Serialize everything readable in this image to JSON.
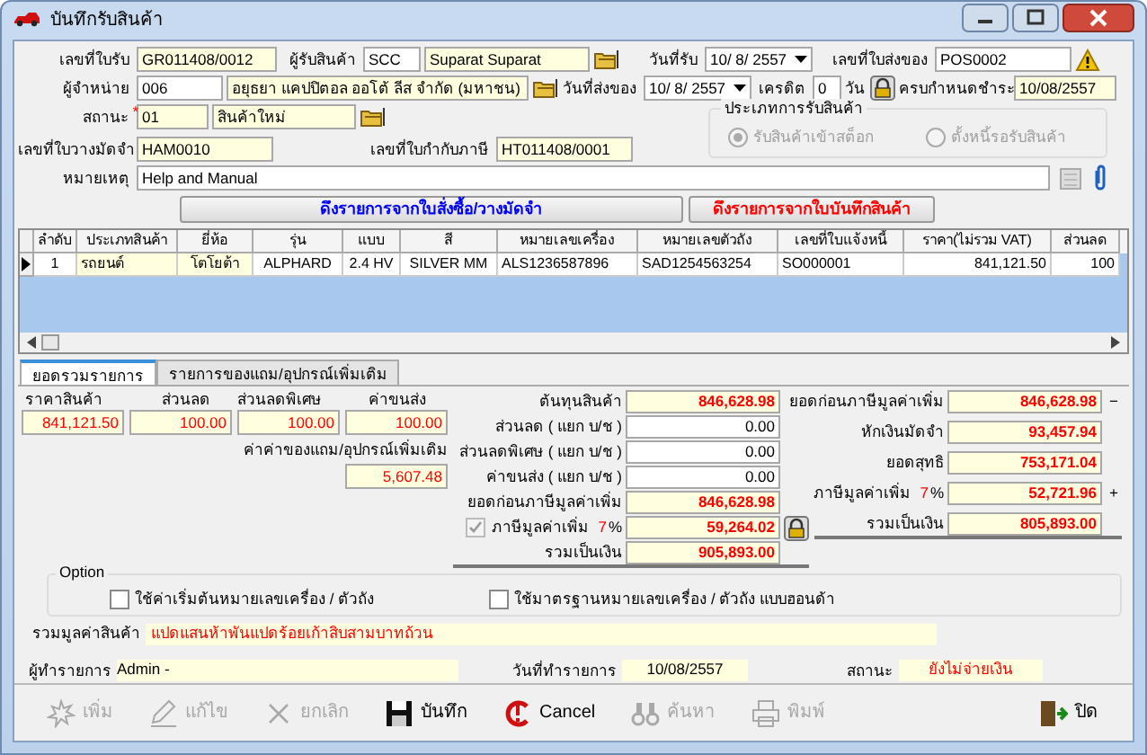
{
  "window": {
    "title": "บันทึกรับสินค้า"
  },
  "header": {
    "receipt_no": {
      "label": "เลขที่ใบรับ",
      "value": "GR011408/0012"
    },
    "receiver": {
      "label": "ผู้รับสินค้า",
      "code": "SCC",
      "name": "Suparat Suparat"
    },
    "receive_date": {
      "label": "วันที่รับ",
      "value": "10/ 8/ 2557"
    },
    "delivery_no": {
      "label": "เลขที่ใบส่งของ",
      "value": "POS0002"
    },
    "supplier": {
      "label": "ผู้จำหน่าย",
      "code": "006",
      "name": "อยุธยา แคปปิตอล ออโต้ ลีส จำกัด (มหาชน)"
    },
    "delivery_date": {
      "label": "วันที่ส่งของ",
      "value": "10/ 8/ 2557"
    },
    "credit": {
      "label": "เครดิต",
      "value": "0",
      "unit": "วัน"
    },
    "due_date": {
      "label": "ครบกำหนดชำระ",
      "value": "10/08/2557"
    },
    "status": {
      "label": "สถานะ",
      "required": true,
      "required_mark": "*",
      "code": "01",
      "name": "สินค้าใหม่"
    },
    "deposit_no": {
      "label": "เลขที่ใบวางมัดจำ",
      "value": "HAM0010"
    },
    "tax_invoice_no": {
      "label": "เลขที่ใบกำกับภาษี",
      "value": "HT011408/0001"
    },
    "receive_type": {
      "title": "ประเภทการรับสินค้า",
      "disabled": true,
      "options": [
        {
          "label": "รับสินค้าเข้าสต็อก",
          "selected": true
        },
        {
          "label": "ตั้งหนี้รอรับสินค้า",
          "selected": false
        }
      ]
    },
    "remark": {
      "label": "หมายเหตุ",
      "value": "Help and Manual"
    }
  },
  "pull_buttons": [
    {
      "label": "ดึงรายการจากใบสั่งซื้อ/วางมัดจำ",
      "color": "#0000ff"
    },
    {
      "label": "ดึงรายการจากใบบันทึกสินค้า",
      "color": "#ff0000"
    }
  ],
  "table": {
    "columns": [
      "ลำดับ",
      "ประเภทสินค้า",
      "ยี่ห้อ",
      "รุ่น",
      "แบบ",
      "สี",
      "หมายเลขเครื่อง",
      "หมายเลขตัวถัง",
      "เลขที่ใบแจ้งหนี้",
      "ราคา(ไม่รวม VAT)",
      "ส่วนลด"
    ],
    "rows": [
      {
        "selected": true,
        "cells": [
          "1",
          "รถยนต์",
          "โตโยต้า",
          "ALPHARD",
          "2.4 HV",
          "SILVER MM",
          "ALS1236587896",
          "SAD1254563254",
          "SO000001",
          "841,121.50",
          "100"
        ]
      }
    ]
  },
  "tabs": [
    {
      "label": "ยอดรวมรายการ",
      "selected": true
    },
    {
      "label": "รายการของแถม/อุปกรณ์เพิ่มเติม",
      "selected": false
    }
  ],
  "summary": {
    "line_totals": [
      {
        "label": "ราคาสินค้า",
        "value": "841,121.50"
      },
      {
        "label": "ส่วนลด",
        "value": "100.00"
      },
      {
        "label": "ส่วนลดพิเศษ",
        "value": "100.00"
      },
      {
        "label": "ค่าขนส่ง",
        "value": "100.00"
      }
    ],
    "extras": {
      "label": "ค่าค่าของแถม/อุปกรณ์เพิ่มเติม",
      "value": "5,607.48"
    },
    "middle": [
      {
        "kind": "total",
        "label": "ต้นทุนสินค้า",
        "value": "846,628.98"
      },
      {
        "kind": "input",
        "label": "ส่วนลด ( แยก บ/ช )",
        "value": "0.00"
      },
      {
        "kind": "input",
        "label": "ส่วนลดพิเศษ ( แยก บ/ช )",
        "value": "0.00"
      },
      {
        "kind": "input",
        "label": "ค่าขนส่ง ( แยก บ/ช )",
        "value": "0.00"
      },
      {
        "kind": "total",
        "label": "ยอดก่อนภาษีมูลค่าเพิ่ม",
        "value": "846,628.98"
      },
      {
        "kind": "vat",
        "label": "ภาษีมูลค่าเพิ่ม",
        "checked": true,
        "rate": "7",
        "unit": "%",
        "value": "59,264.02"
      },
      {
        "kind": "grand",
        "label": "รวมเป็นเงิน",
        "value": "905,893.00"
      }
    ],
    "right": [
      {
        "kind": "total",
        "label": "ยอดก่อนภาษีมูลค่าเพิ่ม",
        "value": "846,628.98",
        "sign": "−"
      },
      {
        "kind": "total",
        "label": "หักเงินมัดจำ",
        "value": "93,457.94"
      },
      {
        "kind": "total",
        "label": "ยอดสุทธิ",
        "value": "753,171.04"
      },
      {
        "kind": "vat",
        "label": "ภาษีมูลค่าเพิ่ม",
        "rate": "7",
        "unit": "%",
        "value": "52,721.96",
        "sign": "+"
      },
      {
        "kind": "grand",
        "label": "รวมเป็นเงิน",
        "value": "805,893.00"
      }
    ]
  },
  "options": {
    "title": "Option",
    "items": [
      {
        "label": "ใช้ค่าเริ่มต้นหมายเลขเครื่อง / ตัวถัง",
        "checked": false
      },
      {
        "label": "ใช้มาตรฐานหมายเลขเครื่อง / ตัวถัง แบบฮอนด้า",
        "checked": false
      }
    ]
  },
  "total_in_words": {
    "label": "รวมมูลค่าสินค้า",
    "value": "แปดแสนห้าพันแปดร้อยเก้าสิบสามบาทถ้วน"
  },
  "status_bar": [
    {
      "label": "ผู้ทำรายการ",
      "value": "Admin -"
    },
    {
      "label": "วันที่ทำรายการ",
      "value": "10/08/2557"
    },
    {
      "label": "สถานะ",
      "value": "ยังไม่จ่ายเงิน"
    }
  ],
  "toolbar": [
    {
      "label": "เพิ่ม",
      "disabled": true
    },
    {
      "label": "แก้ไข",
      "disabled": true
    },
    {
      "label": "ยกเลิก",
      "disabled": true
    },
    {
      "label": "บันทึก",
      "disabled": false
    },
    {
      "label": "Cancel",
      "disabled": false
    },
    {
      "label": "ค้นหา",
      "disabled": true
    },
    {
      "label": "พิมพ์",
      "disabled": true
    },
    {
      "label": "ปิด",
      "disabled": false
    }
  ]
}
